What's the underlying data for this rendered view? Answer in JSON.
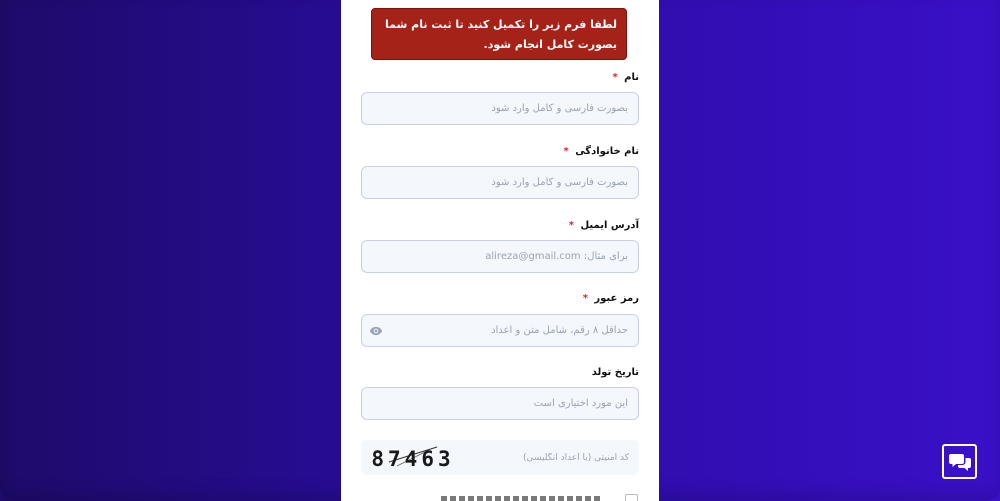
{
  "alert": {
    "message": "لطفا فرم زیر را تکمیل کنید تا ثبت نام شما بصورت کامل انجام شود."
  },
  "fields": {
    "first_name": {
      "label": "نام",
      "required": "*",
      "placeholder": "بصورت فارسی و کامل وارد شود"
    },
    "last_name": {
      "label": "نام خانوادگی",
      "required": "*",
      "placeholder": "بصورت فارسی و کامل وارد شود"
    },
    "email": {
      "label": "آدرس ایمیل",
      "required": "*",
      "placeholder": "برای مثال: alireza@gmail.com"
    },
    "password": {
      "label": "رمز عبور",
      "required": "*",
      "placeholder": "حداقل ۸ رقم، شامل متن و اعداد",
      "icon": "eye-icon"
    },
    "birth_date": {
      "label": "تاریخ تولد",
      "placeholder": "این مورد اختیاری است"
    }
  },
  "captcha": {
    "code": "87463",
    "placeholder": "کد امنیتی (با اعداد انگلیسی)"
  },
  "chat": {
    "icon": "chat-bubbles-icon"
  },
  "colors": {
    "alert_bg": "#a52218",
    "required": "#e02424",
    "input_bg": "#f4f7fb",
    "input_border": "#c9d0e6",
    "bg_left": "#1e0b6a",
    "bg_right": "#3a10c8"
  }
}
